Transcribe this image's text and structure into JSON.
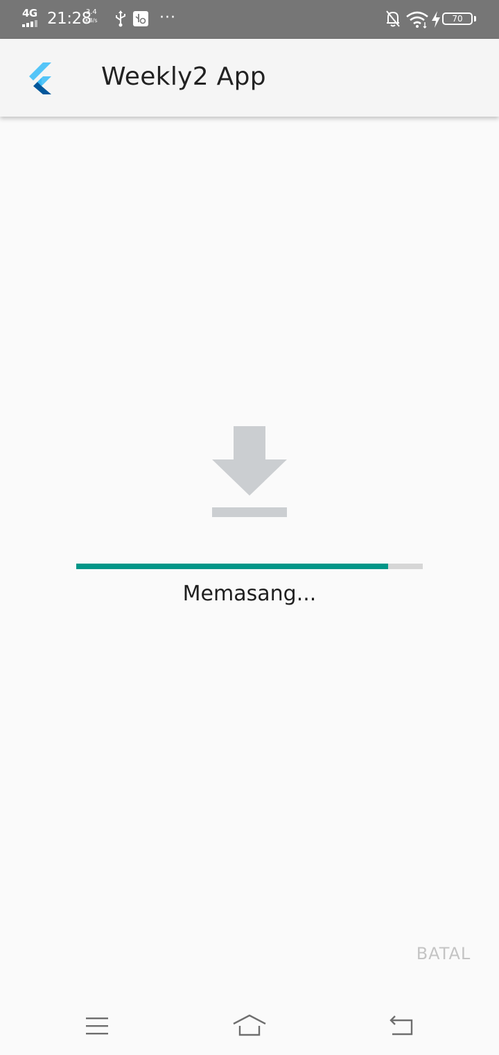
{
  "status_bar": {
    "network_type": "4G",
    "time": "21:28",
    "net_speed_value": "3.4",
    "net_speed_unit": "KB/s",
    "more_indicator": "···",
    "battery_level": "70",
    "icons": [
      "signal-icon",
      "usb-icon",
      "usb-debug-icon",
      "more-icon",
      "dnd-icon",
      "wifi-icon",
      "charging-icon",
      "battery-icon"
    ]
  },
  "app_bar": {
    "title": "Weekly2 App",
    "logo_icon": "flutter-logo-icon"
  },
  "install": {
    "icon": "download-icon",
    "progress": 0.9,
    "status_text": "Memasang...",
    "cancel_label": "BATAL"
  },
  "nav_bar": {
    "icons": [
      "menu-icon",
      "home-icon",
      "back-icon"
    ]
  },
  "colors": {
    "status_bar_bg": "#767676",
    "app_bar_bg": "#f5f5f5",
    "page_bg": "#fafafa",
    "progress_fill": "#009688",
    "progress_track": "#d6d6d6",
    "download_icon": "#cbced1",
    "cancel_text": "#c4c4c4"
  }
}
